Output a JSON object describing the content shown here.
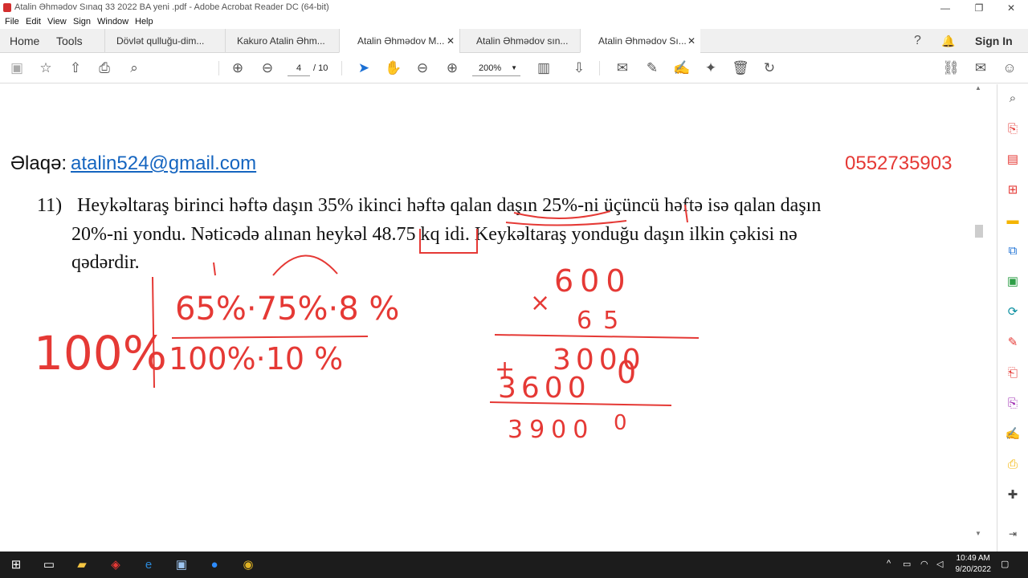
{
  "window": {
    "title": "Atalin Əhmədov Sınaq 33 2022 BA yeni .pdf - Adobe Acrobat Reader DC (64-bit)",
    "minimize": "—",
    "maximize": "❐",
    "close": "✕"
  },
  "menu": [
    "File",
    "Edit",
    "View",
    "Sign",
    "Window",
    "Help"
  ],
  "nav": {
    "home": "Home",
    "tools": "Tools"
  },
  "tabs": [
    {
      "label": "Dövlət qulluğu-dim...",
      "active": false,
      "closable": false
    },
    {
      "label": "Kakuro Atalin Əhm...",
      "active": false,
      "closable": false
    },
    {
      "label": "Atalin Əhmədov M...",
      "active": true,
      "closable": true
    },
    {
      "label": "Atalin Əhmədov sın...",
      "active": false,
      "closable": false
    },
    {
      "label": "Atalin Əhmədov Sı...",
      "active": true,
      "closable": true
    }
  ],
  "header_right": {
    "help": "?",
    "bell": "🔔",
    "sign_in": "Sign In"
  },
  "toolbar": {
    "page_current": "4",
    "page_total": "/ 10",
    "zoom": "200%",
    "zoom_caret": "▼"
  },
  "document": {
    "contact_label": "Əlaqə:",
    "email": "atalin524@gmail.com",
    "phone": "0552735903",
    "question_number": "11)",
    "question_lines": [
      "Heykəltaraş birinci həftə daşın 35% ikinci həftə qalan daşın 25%-ni üçüncü həftə isə qalan daşın",
      "20%-ni yondu. Nəticədə alınan heykəl 48.75 kq idi. Keykəltaraş yonduğu daşın ilkin çəkisi nə",
      "qədərdir."
    ]
  },
  "annotations": {
    "left_work": {
      "top": "65%·75%·8  %",
      "bottom": "100%·10  %",
      "whole": "100%"
    },
    "right_work": {
      "mult_top": "600",
      "mult_sign": "×",
      "mult_bottom": "65",
      "row1": "3000",
      "row2": "3600",
      "row2_end": "0",
      "plus": "+",
      "result": "3900",
      "result_end": "0"
    }
  },
  "taskbar": {
    "time": "10:49 AM",
    "date": "9/20/2022"
  },
  "colors": {
    "ink": "#e53935",
    "link": "#1565c0",
    "phone": "#e53935",
    "tabbar": "#f0f0f0",
    "taskbar": "#1c1c1c"
  }
}
